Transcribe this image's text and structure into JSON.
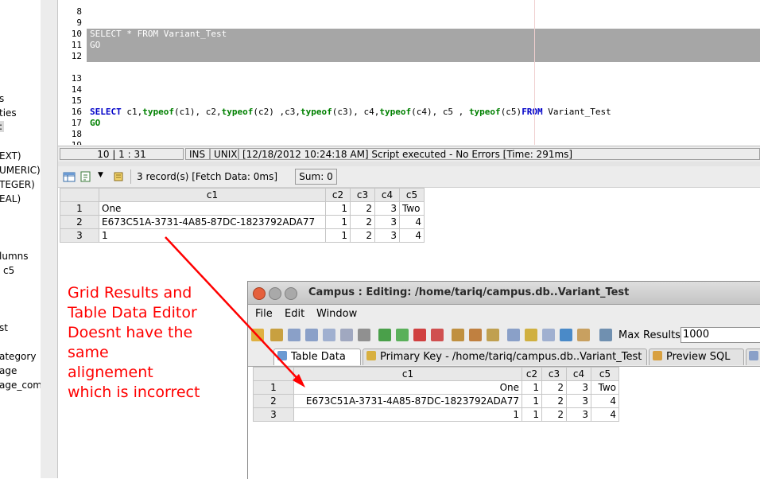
{
  "sidebar": {
    "items": [
      "s",
      "ties",
      ":",
      "EXT)",
      "UMERIC)",
      "TEGER)",
      "EAL)",
      "lumns",
      "c5",
      "st",
      "ategory",
      "age",
      "age_com"
    ]
  },
  "editor": {
    "line_numbers": [
      "8",
      "9",
      "10",
      "11",
      "12",
      "13",
      "14",
      "15",
      "16",
      "17",
      "18",
      "19"
    ],
    "line10": "SELECT * FROM Variant_Test",
    "line11": "GO",
    "line17": {
      "kw_select": "SELECT",
      "t1": " c1,",
      "f1": "typeof",
      "t2": "(c1), c2,",
      "f2": "typeof",
      "t3": "(c2) ,c3,",
      "f3": "typeof",
      "t4": "(c3), c4,",
      "f4": "typeof",
      "t5": "(c4), c5 , ",
      "f5": "typeof",
      "t6": "(c5)",
      "kw_from": "FROM",
      "t7": " Variant_Test"
    },
    "line18": "GO"
  },
  "status": {
    "position": "10 | 1 : 31",
    "ins": "INS",
    "unix": "UNIX",
    "message": "[12/18/2012 10:24:18 AM] Script executed - No Errors [Time: 291ms]"
  },
  "results_toolbar": {
    "records": "3 record(s) [Fetch Data: 0ms]",
    "sum": "Sum: 0"
  },
  "grid1": {
    "columns": [
      "c1",
      "c2",
      "c3",
      "c4",
      "c5"
    ],
    "rows": [
      {
        "n": "1",
        "c1": "One",
        "c2": "1",
        "c3": "2",
        "c4": "3",
        "c5": "Two"
      },
      {
        "n": "2",
        "c1": "E673C51A-3731-4A85-87DC-1823792ADA77",
        "c2": "1",
        "c3": "2",
        "c4": "3",
        "c5": "4"
      },
      {
        "n": "3",
        "c1": "1",
        "c2": "1",
        "c3": "2",
        "c4": "3",
        "c5": "4"
      }
    ]
  },
  "annotation": {
    "lines": [
      "Grid Results and",
      "Table Data Editor",
      "Doesnt have the",
      "same",
      "alignement",
      "which is incorrect"
    ],
    "color": "#ff0000"
  },
  "window": {
    "title": "Campus : Editing: /home/tariq/campus.db..Variant_Test",
    "menu": {
      "file": "File",
      "edit": "Edit",
      "window": "Window"
    },
    "max_results_label": "Max Results:",
    "max_results_value": "1000",
    "tabs": {
      "table_data": "Table Data",
      "primary_key": "Primary Key - /home/tariq/campus.db..Variant_Test",
      "preview_sql": "Preview SQL"
    }
  },
  "grid2": {
    "columns": [
      "c1",
      "c2",
      "c3",
      "c4",
      "c5"
    ],
    "rows": [
      {
        "n": "1",
        "c1": "One",
        "c2": "1",
        "c3": "2",
        "c4": "3",
        "c5": "Two"
      },
      {
        "n": "2",
        "c1": "E673C51A-3731-4A85-87DC-1823792ADA77",
        "c2": "1",
        "c3": "2",
        "c4": "3",
        "c5": "4"
      },
      {
        "n": "3",
        "c1": "1",
        "c2": "1",
        "c3": "2",
        "c4": "3",
        "c5": "4"
      }
    ]
  }
}
